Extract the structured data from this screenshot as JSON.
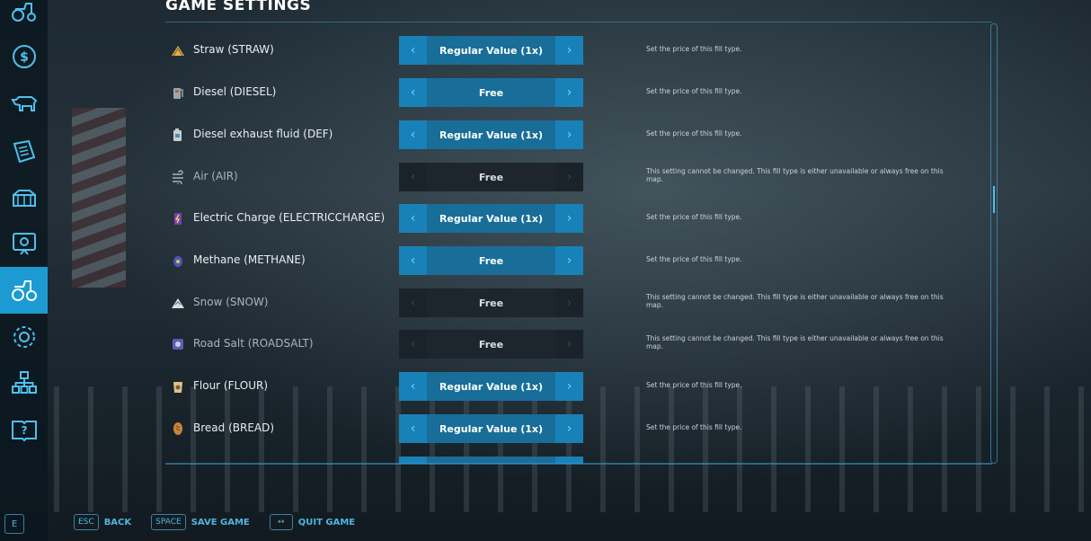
{
  "header": {
    "title": "GAME SETTINGS"
  },
  "sidebar": {
    "items": [
      {
        "icon": "tractor-icon"
      },
      {
        "icon": "dollar-icon"
      },
      {
        "icon": "cow-icon"
      },
      {
        "icon": "contracts-icon"
      },
      {
        "icon": "production-icon"
      },
      {
        "icon": "map-icon"
      },
      {
        "icon": "vehicles-icon",
        "active": true
      },
      {
        "icon": "gear-icon"
      },
      {
        "icon": "hierarchy-icon"
      },
      {
        "icon": "help-book-icon"
      }
    ],
    "bottom_key": "E"
  },
  "settings": [
    {
      "name": "Straw (STRAW)",
      "value": "Regular Value (1x)",
      "desc": "Set the price of this fill type.",
      "enabled": true,
      "icon": "straw-icon",
      "color": "#e0b050"
    },
    {
      "name": "Diesel (DIESEL)",
      "value": "Free",
      "desc": "Set the price of this fill type.",
      "enabled": true,
      "icon": "diesel-icon",
      "color": "#9aa6ad"
    },
    {
      "name": "Diesel exhaust fluid (DEF)",
      "value": "Regular Value (1x)",
      "desc": "Set the price of this fill type.",
      "enabled": true,
      "icon": "def-icon",
      "color": "#c7ced2"
    },
    {
      "name": "Air (AIR)",
      "value": "Free",
      "desc": "This setting cannot be changed. This fill type is either unavailable or always free on this map.",
      "enabled": false,
      "icon": "air-icon",
      "color": "#aab4ba"
    },
    {
      "name": "Electric Charge (ELECTRICCHARGE)",
      "value": "Regular Value (1x)",
      "desc": "Set the price of this fill type.",
      "enabled": true,
      "icon": "electric-icon",
      "color": "#b070e0"
    },
    {
      "name": "Methane (METHANE)",
      "value": "Free",
      "desc": "Set the price of this fill type.",
      "enabled": true,
      "icon": "methane-icon",
      "color": "#7080e0"
    },
    {
      "name": "Snow (SNOW)",
      "value": "Free",
      "desc": "This setting cannot be changed. This fill type is either unavailable or always free on this map.",
      "enabled": false,
      "icon": "snow-icon",
      "color": "#d8dde0"
    },
    {
      "name": "Road Salt (ROADSALT)",
      "value": "Free",
      "desc": "This setting cannot be changed. This fill type is either unavailable or always free on this map.",
      "enabled": false,
      "icon": "roadsalt-icon",
      "color": "#8c90d8"
    },
    {
      "name": "Flour (FLOUR)",
      "value": "Regular Value (1x)",
      "desc": "Set the price of this fill type.",
      "enabled": true,
      "icon": "flour-icon",
      "color": "#e0c08a"
    },
    {
      "name": "Bread (BREAD)",
      "value": "Regular Value (1x)",
      "desc": "Set the price of this fill type.",
      "enabled": true,
      "icon": "bread-icon",
      "color": "#c8843a"
    }
  ],
  "footer": {
    "back": {
      "key": "ESC",
      "label": "BACK"
    },
    "save": {
      "key": "SPACE",
      "label": "SAVE GAME"
    },
    "quit": {
      "key": "↔",
      "label": "QUIT GAME"
    }
  },
  "arrows": {
    "left": "‹",
    "right": "›"
  }
}
